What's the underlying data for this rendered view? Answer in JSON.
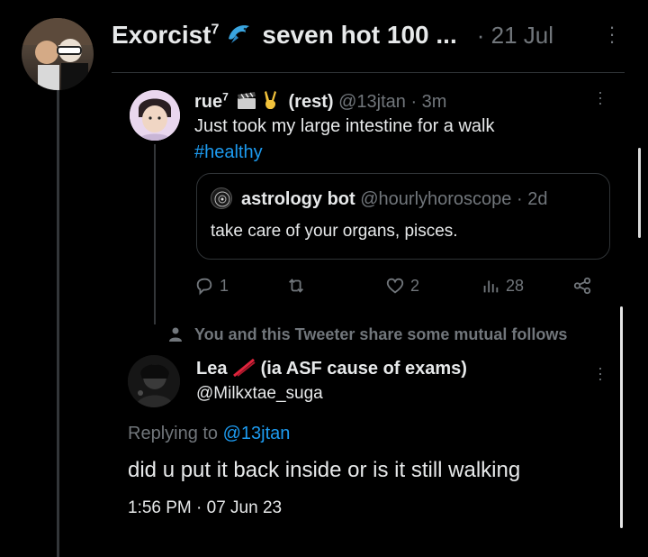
{
  "main_tweet": {
    "display_name": "Exorcist",
    "superscript": "7",
    "emoji_label": "dolphin",
    "name_suffix": "seven hot 100 ...",
    "date": "· 21 Jul"
  },
  "reply_tweet": {
    "display_name": "rue",
    "superscript": "7",
    "badge_text": "(rest)",
    "handle": "@13jtan",
    "time": "· 3m",
    "text": "Just took my large intestine for a walk",
    "hashtag": "#healthy"
  },
  "quoted_tweet": {
    "display_name": "astrology bot",
    "handle": "@hourlyhoroscope",
    "time": "· 2d",
    "text": "take care of your organs, pisces."
  },
  "actions": {
    "replies": "1",
    "retweets": "",
    "likes": "2",
    "views": "28"
  },
  "mutual_notice": "You and this Tweeter share some mutual follows",
  "focused_reply": {
    "display_name": "Lea",
    "name_suffix": "(ia ASF cause of exams)",
    "handle": "@Milkxtae_suga",
    "replying_prefix": "Replying to",
    "replying_handle": "@13jtan",
    "text": "did u put it back inside or is it still walking",
    "timestamp": "1:56 PM · 07 Jun 23"
  },
  "colors": {
    "background": "#000000",
    "accent": "#1d9bf0",
    "muted": "#71767b",
    "border": "#2f3336"
  }
}
